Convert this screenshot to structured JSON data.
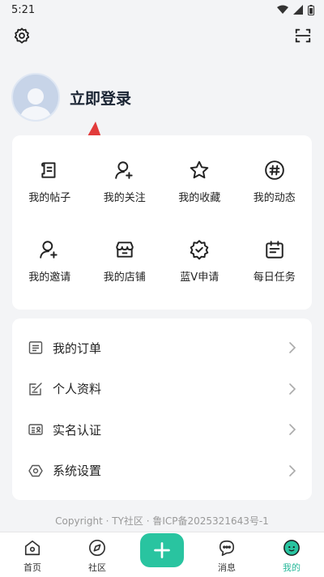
{
  "status_bar": {
    "time": "5:21"
  },
  "profile": {
    "login_text": "立即登录"
  },
  "grid": [
    {
      "label": "我的帖子",
      "icon": "post-icon"
    },
    {
      "label": "我的关注",
      "icon": "user-plus-icon"
    },
    {
      "label": "我的收藏",
      "icon": "star-icon"
    },
    {
      "label": "我的动态",
      "icon": "hashtag-icon"
    },
    {
      "label": "我的邀请",
      "icon": "invite-icon"
    },
    {
      "label": "我的店铺",
      "icon": "store-icon"
    },
    {
      "label": "蓝V申请",
      "icon": "verified-badge-icon"
    },
    {
      "label": "每日任务",
      "icon": "calendar-icon"
    }
  ],
  "list": [
    {
      "label": "我的订单",
      "icon": "order-icon"
    },
    {
      "label": "个人资料",
      "icon": "edit-profile-icon"
    },
    {
      "label": "实名认证",
      "icon": "id-card-icon"
    },
    {
      "label": "系统设置",
      "icon": "settings-hex-icon"
    }
  ],
  "footer": {
    "text": "Copyright · TY社区 · 鲁ICP备2025321643号-1"
  },
  "tabbar": {
    "tabs": [
      {
        "label": "首页",
        "icon": "home-icon"
      },
      {
        "label": "社区",
        "icon": "compass-icon"
      },
      {
        "label": "",
        "icon": "plus-icon"
      },
      {
        "label": "消息",
        "icon": "message-icon"
      },
      {
        "label": "我的",
        "icon": "profile-face-icon"
      }
    ],
    "active_index": 4,
    "accent": "#29c4a0"
  }
}
